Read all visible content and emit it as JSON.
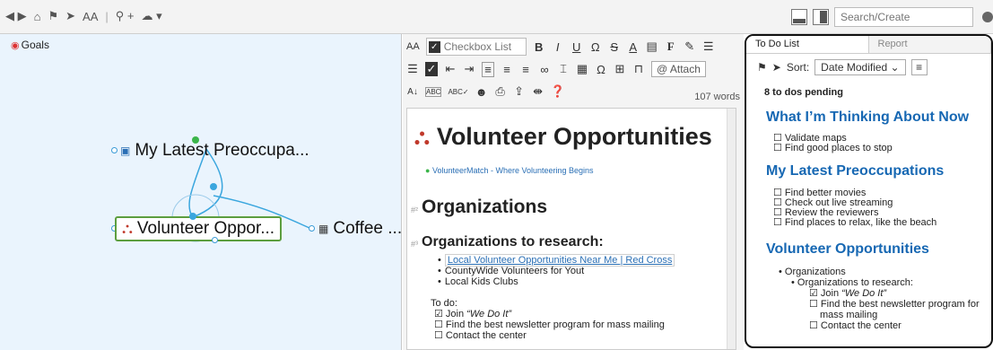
{
  "toolbar": {
    "search_placeholder": "Search/Create",
    "font_size_label": "AA"
  },
  "map": {
    "title": "Goals",
    "nodes": {
      "preoccupations": "My Latest Preoccupa...",
      "volunteer": "Volunteer Oppor...",
      "coffee": "Coffee ..."
    }
  },
  "editor": {
    "style_select": "Checkbox List",
    "attach_label": "Attach",
    "word_count": "107 words",
    "doc": {
      "title": "Volunteer Opportunities",
      "subtitle_link": "VolunteerMatch - Where Volunteering Begins",
      "h2": "Organizations",
      "h3": "Organizations to research:",
      "orgs": [
        "Local Volunteer Opportunities Near Me | Red Cross",
        "CountyWide Volunteers for Yout",
        "Local Kids Clubs"
      ],
      "todo_label": "To do:",
      "todos": [
        {
          "checked": true,
          "prefix": "Join ",
          "emph": "“We Do It”"
        },
        {
          "checked": false,
          "prefix": "Find the best newsletter program for mass mailing",
          "emph": ""
        },
        {
          "checked": false,
          "prefix": "Contact the center",
          "emph": ""
        }
      ]
    }
  },
  "side": {
    "tabs": [
      "To Do List",
      "Report"
    ],
    "sort_label": "Sort:",
    "sort_value": "Date Modified",
    "pending": "8 to dos pending",
    "sections": [
      {
        "title": "What I’m Thinking About Now",
        "items": [
          "Validate maps",
          "Find good places to stop"
        ]
      },
      {
        "title": "My Latest Preoccupations",
        "items": [
          "Find better movies",
          "Check out live streaming",
          "Review the reviewers",
          "Find places to relax, like the beach"
        ]
      },
      {
        "title": "Volunteer Opportunities",
        "items": []
      }
    ],
    "vol": {
      "org": "Organizations",
      "research": "Organizations to research:",
      "join_prefix": "Join ",
      "join_emph": "“We Do It”",
      "newsletter_1": "Find the best newsletter program for",
      "newsletter_2": "mass mailing",
      "contact": "Contact the center"
    }
  },
  "colors": {
    "accent": "#1768b3",
    "map_bg": "#eaf4fd",
    "selected_border": "#5c9e3f"
  }
}
